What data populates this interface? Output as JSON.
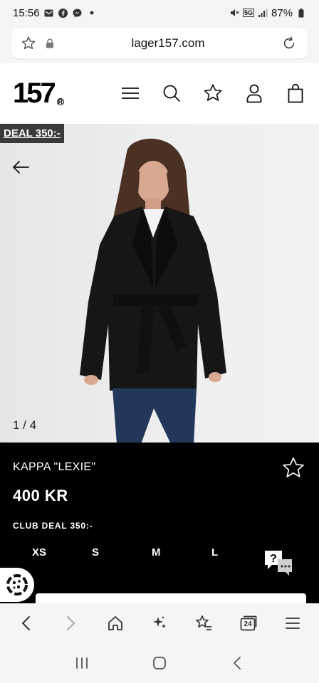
{
  "status_bar": {
    "time": "15:56",
    "battery": "87%",
    "network": "5G"
  },
  "browser": {
    "url": "lager157.com"
  },
  "site": {
    "logo_text": "157"
  },
  "hero": {
    "deal_badge": "DEAL 350:-",
    "image_counter": "1 / 4"
  },
  "product": {
    "name": "KAPPA \"LEXIE\"",
    "price": "400 KR",
    "club_deal": "CLUB DEAL 350:-",
    "sizes": [
      "XS",
      "S",
      "M",
      "L"
    ]
  },
  "help_widget": {
    "label": "?"
  },
  "browser_nav": {
    "tab_count": "24"
  },
  "colors": {
    "info_bg": "#000000",
    "badge_bg": "#3a3a3a",
    "chrome_bg": "#f5f5f5"
  }
}
